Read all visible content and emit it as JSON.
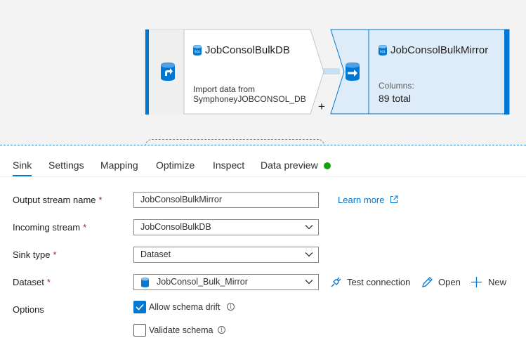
{
  "canvas": {
    "source_node": {
      "title": "JobConsolBulkDB",
      "description": "Import data from SymphoneyJOBCONSOL_DB",
      "description_line1": "Import data from",
      "description_line2": "SymphoneyJOBCONSOL_DB",
      "icon": "database-import-icon",
      "title_icon": "sql-database-icon",
      "add_symbol": "+"
    },
    "sink_node": {
      "title": "JobConsolBulkMirror",
      "columns_label": "Columns:",
      "columns_value": "89 total",
      "icon": "database-export-icon",
      "title_icon": "sql-database-icon"
    },
    "colors": {
      "accent": "#0078d4",
      "selected_fill": "#deecf9",
      "canvas_bg": "#f3f3f3"
    }
  },
  "tabs": [
    {
      "label": "Sink",
      "active": true
    },
    {
      "label": "Settings",
      "active": false
    },
    {
      "label": "Mapping",
      "active": false
    },
    {
      "label": "Optimize",
      "active": false
    },
    {
      "label": "Inspect",
      "active": false
    },
    {
      "label": "Data preview",
      "active": false,
      "status_color": "#13a10e"
    }
  ],
  "form": {
    "output_stream_name": {
      "label": "Output stream name",
      "required": "*",
      "value": "JobConsolBulkMirror"
    },
    "learn_more": {
      "label": "Learn more",
      "icon": "external-link-icon"
    },
    "incoming_stream": {
      "label": "Incoming stream",
      "required": "*",
      "value": "JobConsolBulkDB"
    },
    "sink_type": {
      "label": "Sink type",
      "required": "*",
      "value": "Dataset"
    },
    "dataset": {
      "label": "Dataset",
      "required": "*",
      "value": "JobConsol_Bulk_Mirror",
      "icon": "sql-database-icon"
    },
    "dataset_actions": {
      "test_connection": {
        "label": "Test connection",
        "icon": "plug-icon"
      },
      "open": {
        "label": "Open",
        "icon": "pencil-icon"
      },
      "new": {
        "label": "New",
        "icon": "plus-icon"
      }
    },
    "options": {
      "label": "Options",
      "allow_schema_drift": {
        "label": "Allow schema drift",
        "checked": true,
        "info_icon": "info-icon"
      },
      "validate_schema": {
        "label": "Validate schema",
        "checked": false,
        "info_icon": "info-icon"
      }
    }
  }
}
